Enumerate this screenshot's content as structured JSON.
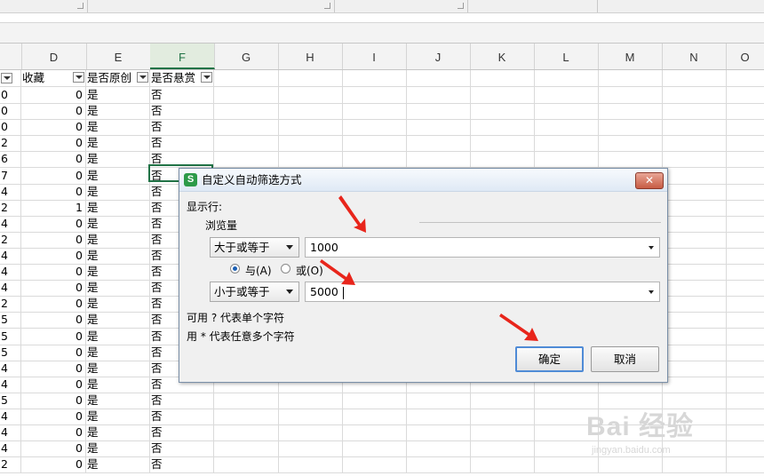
{
  "column_headers": [
    "D",
    "E",
    "F",
    "G",
    "H",
    "I",
    "J",
    "K",
    "L",
    "M",
    "N",
    "O"
  ],
  "active_column": "F",
  "header_row": {
    "col_c": "",
    "col_d": "收藏",
    "col_e": "是否原创",
    "col_f": "是否悬赏"
  },
  "rows": [
    {
      "c": "0",
      "d": "0",
      "e": "是",
      "f": "否"
    },
    {
      "c": "0",
      "d": "0",
      "e": "是",
      "f": "否"
    },
    {
      "c": "0",
      "d": "0",
      "e": "是",
      "f": "否"
    },
    {
      "c": "2",
      "d": "0",
      "e": "是",
      "f": "否"
    },
    {
      "c": "6",
      "d": "0",
      "e": "是",
      "f": "否"
    },
    {
      "c": "7",
      "d": "0",
      "e": "是",
      "f": "否"
    },
    {
      "c": "4",
      "d": "0",
      "e": "是",
      "f": "否"
    },
    {
      "c": "2",
      "d": "1",
      "e": "是",
      "f": "否"
    },
    {
      "c": "4",
      "d": "0",
      "e": "是",
      "f": "否"
    },
    {
      "c": "2",
      "d": "0",
      "e": "是",
      "f": "否"
    },
    {
      "c": "4",
      "d": "0",
      "e": "是",
      "f": "否"
    },
    {
      "c": "4",
      "d": "0",
      "e": "是",
      "f": "否"
    },
    {
      "c": "4",
      "d": "0",
      "e": "是",
      "f": "否"
    },
    {
      "c": "2",
      "d": "0",
      "e": "是",
      "f": "否"
    },
    {
      "c": "5",
      "d": "0",
      "e": "是",
      "f": "否"
    },
    {
      "c": "5",
      "d": "0",
      "e": "是",
      "f": "否"
    },
    {
      "c": "5",
      "d": "0",
      "e": "是",
      "f": "否"
    },
    {
      "c": "4",
      "d": "0",
      "e": "是",
      "f": "否"
    },
    {
      "c": "4",
      "d": "0",
      "e": "是",
      "f": "否"
    },
    {
      "c": "5",
      "d": "0",
      "e": "是",
      "f": "否"
    },
    {
      "c": "4",
      "d": "0",
      "e": "是",
      "f": "否"
    },
    {
      "c": "4",
      "d": "0",
      "e": "是",
      "f": "否"
    },
    {
      "c": "4",
      "d": "0",
      "e": "是",
      "f": "否"
    },
    {
      "c": "2",
      "d": "0",
      "e": "是",
      "f": "否"
    }
  ],
  "dialog": {
    "app_icon_letter": "S",
    "title": "自定义自动筛选方式",
    "close_glyph": "✕",
    "show_rows_label": "显示行:",
    "field_name": "浏览量",
    "condition1": {
      "operator": "大于或等于",
      "value": "1000"
    },
    "logic": {
      "and_label": "与(A)",
      "or_label": "或(O)",
      "selected": "and"
    },
    "condition2": {
      "operator": "小于或等于",
      "value": "5000"
    },
    "hint1": "可用 ? 代表单个字符",
    "hint2": "用 * 代表任意多个字符",
    "ok_label": "确定",
    "cancel_label": "取消"
  },
  "watermark": {
    "brand": "Bai 经验",
    "url": "jingyan.baidu.com"
  },
  "colors": {
    "accent_green": "#217346",
    "arrow_red": "#e8251b",
    "primary_button_border": "#4f8bd6"
  }
}
